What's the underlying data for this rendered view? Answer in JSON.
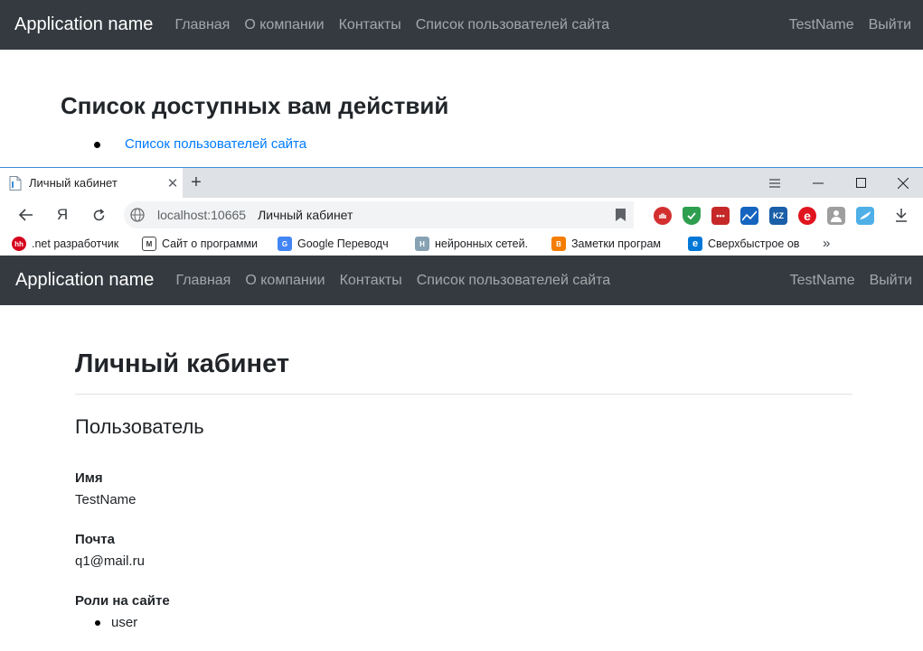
{
  "bg_page": {
    "navbar": {
      "brand": "Application name",
      "links": [
        "Главная",
        "О компании",
        "Контакты",
        "Список пользователей сайта"
      ],
      "user": "TestName",
      "logout": "Выйти"
    },
    "heading": "Список доступных вам действий",
    "actions": [
      "Список пользователей сайта"
    ]
  },
  "browser": {
    "tab_title": "Личный кабинет",
    "url": "localhost:10665",
    "page_title": "Личный кабинет",
    "bookmarks": [
      {
        "label": ".net разработчик",
        "icon": "hh-icon",
        "color": "#d6001c",
        "glyph": "hh"
      },
      {
        "label": "Сайт о программи",
        "icon": "gmail-icon",
        "color": "#ffffff",
        "glyph": "M"
      },
      {
        "label": "Google Переводч",
        "icon": "google-translate-icon",
        "color": "#4285f4",
        "glyph": "G"
      },
      {
        "label": "нейронных сетей.",
        "icon": "habr-icon",
        "color": "#87a2b3",
        "glyph": "H"
      },
      {
        "label": "Заметки програм",
        "icon": "blogger-icon",
        "color": "#f57d00",
        "glyph": "B"
      },
      {
        "label": "Сверхбыстрое ов",
        "icon": "edge-icon",
        "color": "#0078d7",
        "glyph": "e"
      }
    ]
  },
  "page": {
    "navbar": {
      "brand": "Application name",
      "links": [
        "Главная",
        "О компании",
        "Контакты",
        "Список пользователей сайта"
      ],
      "user": "TestName",
      "logout": "Выйти"
    },
    "title": "Личный кабинет",
    "subtitle": "Пользователь",
    "fields": [
      {
        "label": "Имя",
        "value": "TestName"
      },
      {
        "label": "Почта",
        "value": "q1@mail.ru"
      }
    ],
    "roles_label": "Роли на сайте",
    "roles": [
      "user"
    ]
  },
  "colors": {
    "navbar_bg": "#343a40",
    "link": "#007bff",
    "accent_border": "#3b8fd8"
  }
}
